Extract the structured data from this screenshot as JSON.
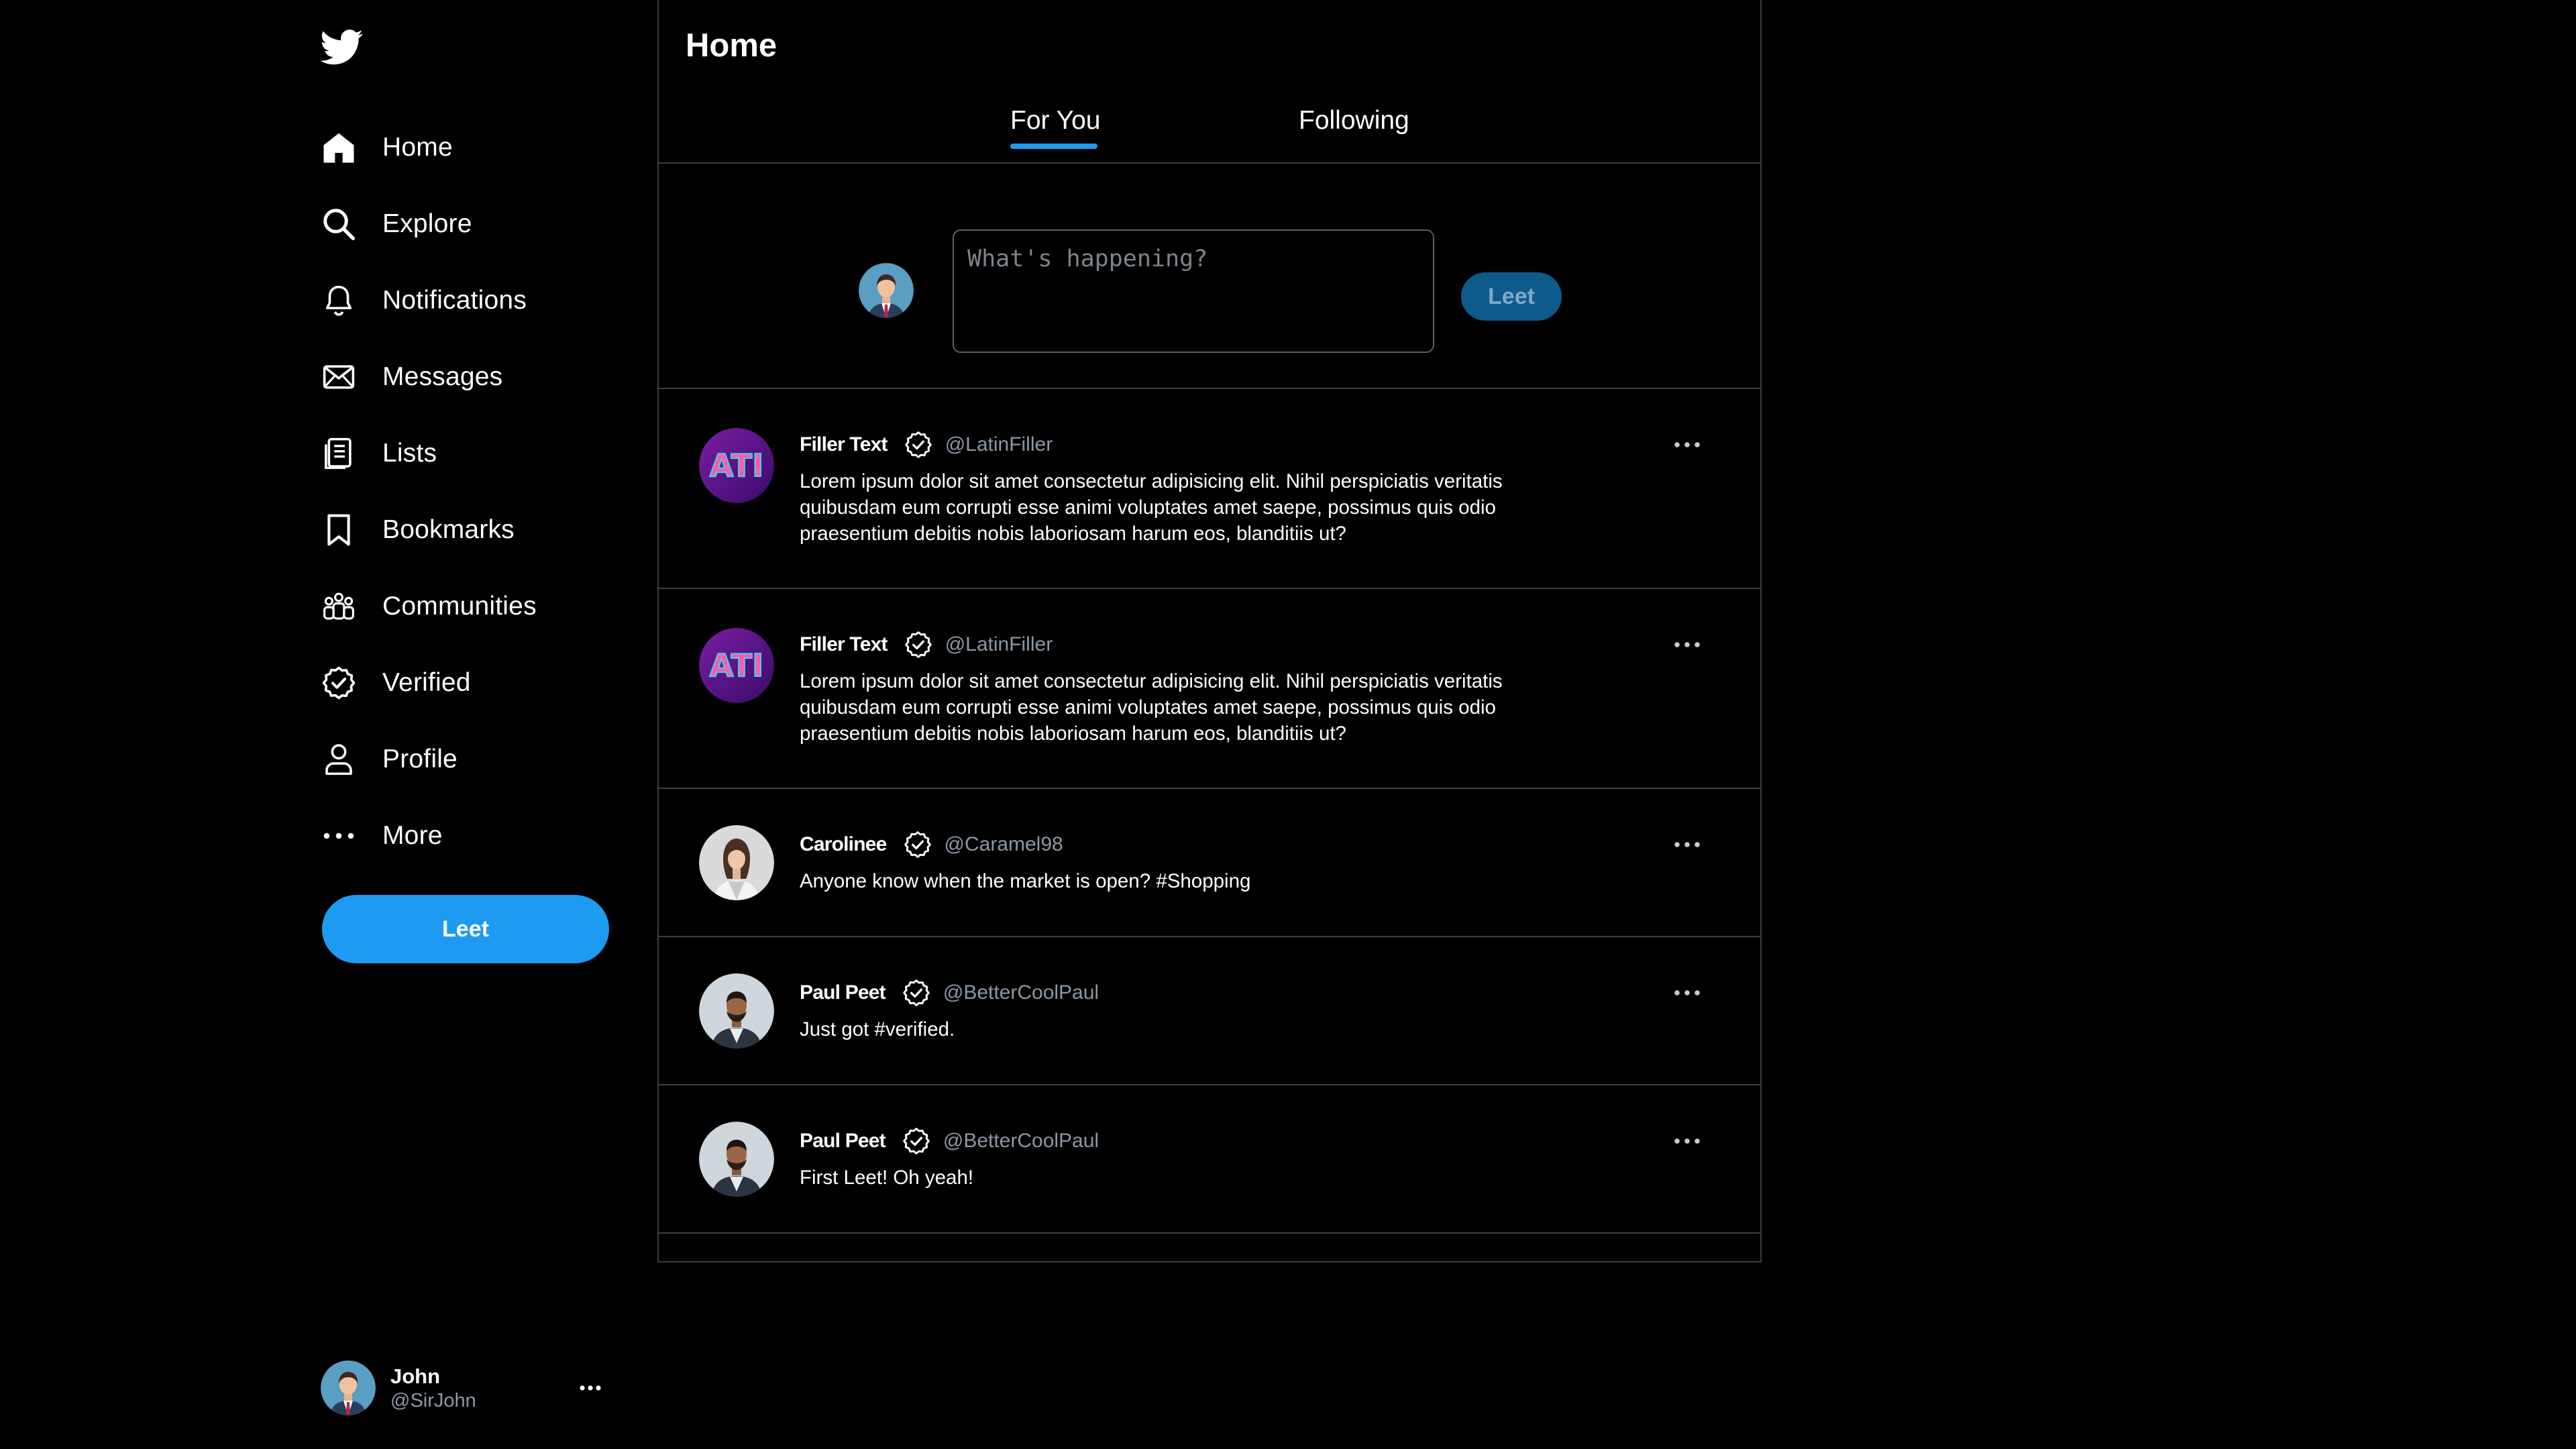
{
  "sidebar": {
    "logo_icon": "bird-logo-icon",
    "nav": [
      {
        "label": "Home",
        "icon": "home-icon"
      },
      {
        "label": "Explore",
        "icon": "search-icon"
      },
      {
        "label": "Notifications",
        "icon": "bell-icon"
      },
      {
        "label": "Messages",
        "icon": "envelope-icon"
      },
      {
        "label": "Lists",
        "icon": "list-icon"
      },
      {
        "label": "Bookmarks",
        "icon": "bookmark-icon"
      },
      {
        "label": "Communities",
        "icon": "people-icon"
      },
      {
        "label": "Verified",
        "icon": "verified-badge-icon"
      },
      {
        "label": "Profile",
        "icon": "person-icon"
      },
      {
        "label": "More",
        "icon": "more-dots-icon"
      }
    ],
    "leet_button": "Leet",
    "user": {
      "name": "John",
      "handle": "@SirJohn"
    }
  },
  "main": {
    "title": "Home",
    "tabs": [
      {
        "label": "For You",
        "active": true
      },
      {
        "label": "Following",
        "active": false
      }
    ],
    "composer": {
      "placeholder": "What's happening?",
      "button": "Leet"
    },
    "posts": [
      {
        "name": "Filler Text",
        "handle": "@LatinFiller",
        "text": "Lorem ipsum dolor sit amet consectetur adipisicing elit. Nihil perspiciatis veritatis quibusdam eum corrupti esse animi voluptates amet saepe, possimus quis odio praesentium debitis nobis laboriosam harum eos, blanditiis ut?",
        "avatar_text": "ATI"
      },
      {
        "name": "Filler Text",
        "handle": "@LatinFiller",
        "text": "Lorem ipsum dolor sit amet consectetur adipisicing elit. Nihil perspiciatis veritatis quibusdam eum corrupti esse animi voluptates amet saepe, possimus quis odio praesentium debitis nobis laboriosam harum eos, blanditiis ut?",
        "avatar_text": "ATI"
      },
      {
        "name": "Carolinee",
        "handle": "@Caramel98",
        "text": "Anyone know when the market is open? #Shopping"
      },
      {
        "name": "Paul Peet",
        "handle": "@BetterCoolPaul",
        "text": "Just got #verified."
      },
      {
        "name": "Paul Peet",
        "handle": "@BetterCoolPaul",
        "text": "First Leet! Oh yeah!"
      }
    ]
  },
  "colors": {
    "accent": "#1d9bf0",
    "background": "#000000",
    "border": "#3a3f44",
    "muted_text": "#8b98a5"
  }
}
